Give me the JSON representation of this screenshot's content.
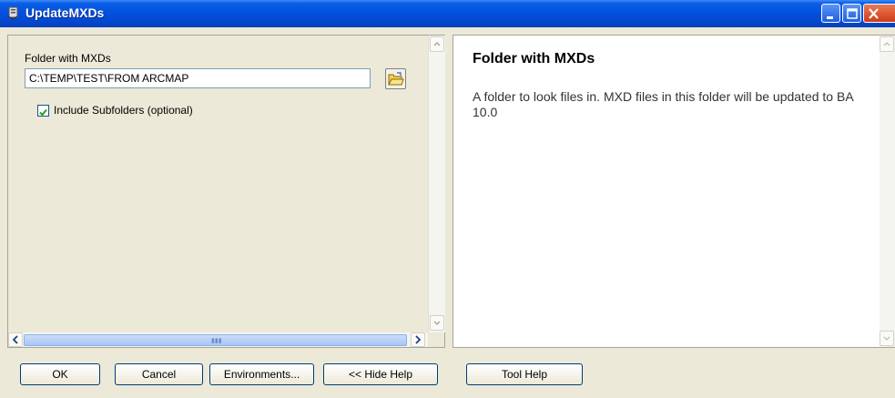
{
  "window": {
    "title": "UpdateMXDs",
    "title_icon": "tool-icon"
  },
  "form": {
    "folder_label": "Folder with MXDs",
    "folder_value": "C:\\TEMP\\TEST\\FROM ARCMAP",
    "include_subfolders_label": "Include Subfolders (optional)",
    "include_subfolders_checked": true
  },
  "help": {
    "title": "Folder with MXDs",
    "body": "A folder to look files in. MXD files in this folder will be updated to BA 10.0"
  },
  "buttons": {
    "ok": "OK",
    "cancel": "Cancel",
    "environments": "Environments...",
    "hide_help": "<< Hide Help",
    "tool_help": "Tool Help"
  },
  "colors": {
    "titlebar": "#0250dc",
    "dialog_bg": "#ece9d8",
    "close": "#cf3c16"
  }
}
